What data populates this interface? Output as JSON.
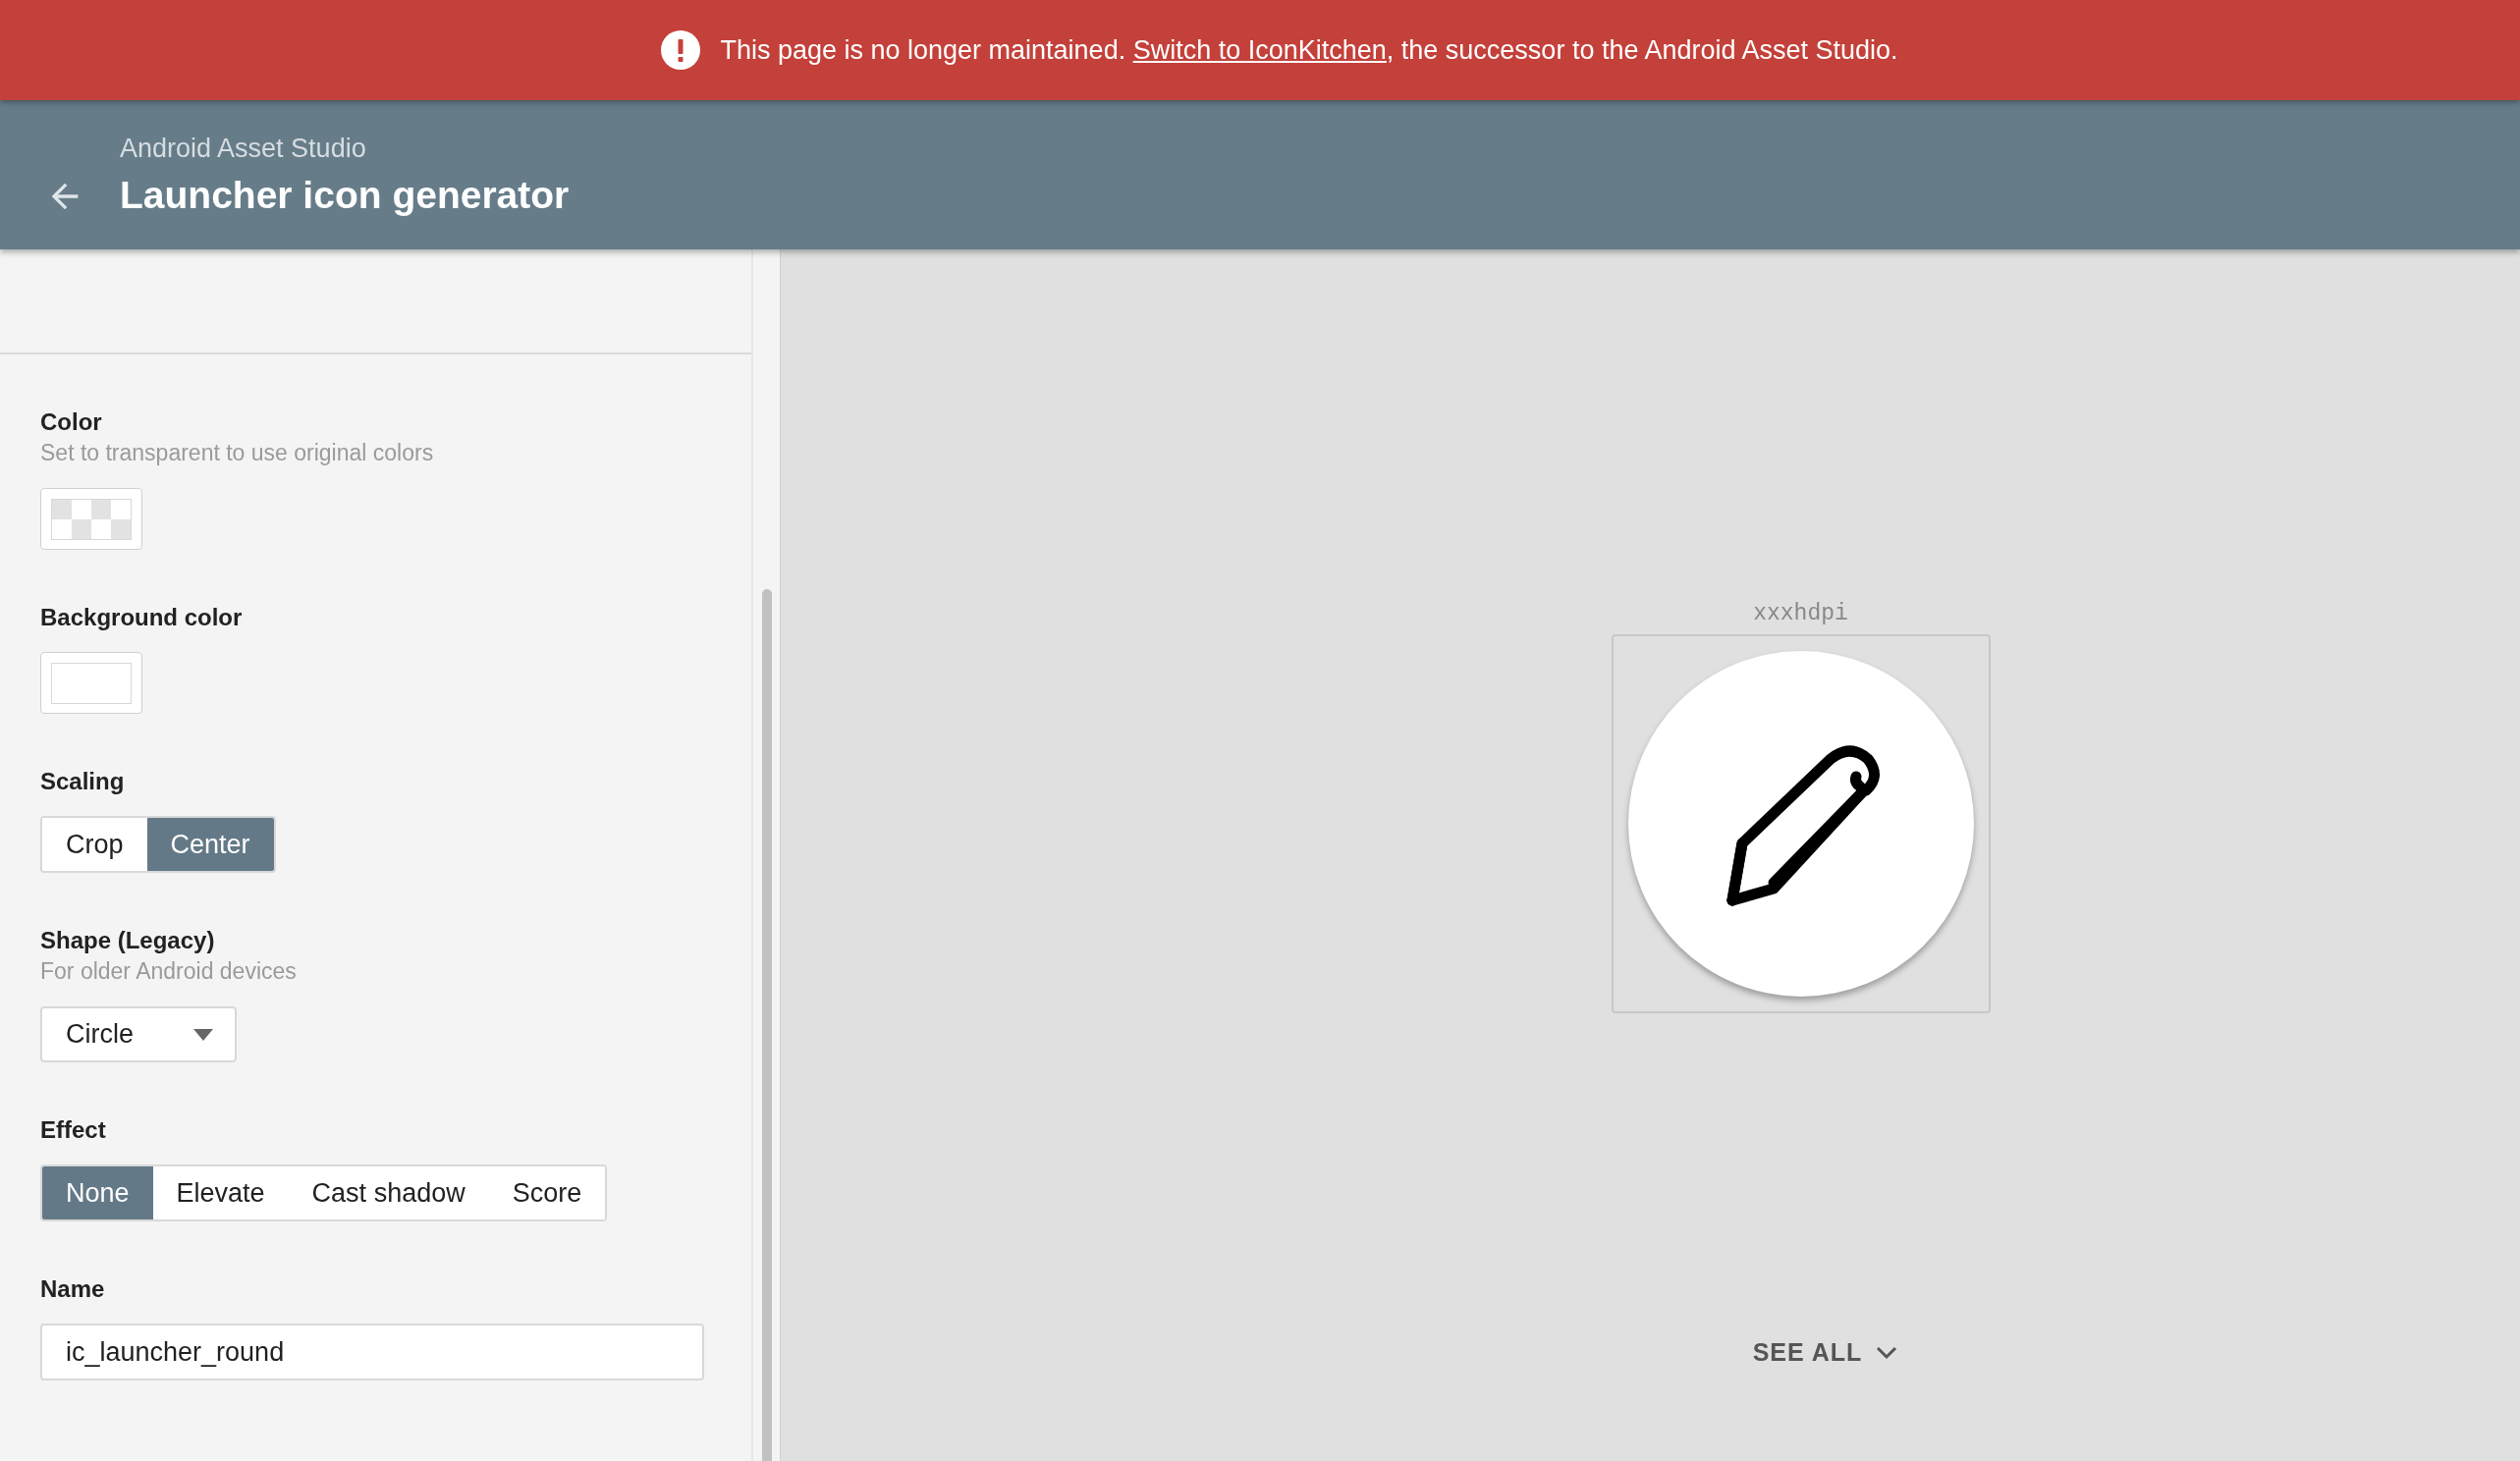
{
  "banner": {
    "message": "This page is no longer maintained. ",
    "link": "Switch to IconKitchen",
    "rest": ", the successor to the Android Asset Studio."
  },
  "header": {
    "subtitle": "Android Asset Studio",
    "title": "Launcher icon generator"
  },
  "fields": [
    {
      "kind": "color",
      "label": "Color",
      "hint": "Set to transparent to use original colors",
      "transparent": true
    },
    {
      "kind": "color",
      "label": "Background color",
      "transparent": false,
      "color": "#ffffff"
    },
    {
      "kind": "segmented",
      "label": "Scaling",
      "options": [
        {
          "label": "Crop",
          "selected": false
        },
        {
          "label": "Center",
          "selected": true
        }
      ]
    },
    {
      "kind": "select",
      "label": "Shape (Legacy)",
      "hint": "For older Android devices",
      "value": "Circle"
    },
    {
      "kind": "segmented",
      "label": "Effect",
      "options": [
        {
          "label": "None",
          "selected": true
        },
        {
          "label": "Elevate",
          "selected": false
        },
        {
          "label": "Cast shadow",
          "selected": false
        },
        {
          "label": "Score",
          "selected": false
        }
      ]
    },
    {
      "kind": "text",
      "label": "Name",
      "value": "ic_launcher_round"
    }
  ],
  "preview": {
    "density": "xxxhdpi",
    "see_all": "SEE ALL"
  }
}
